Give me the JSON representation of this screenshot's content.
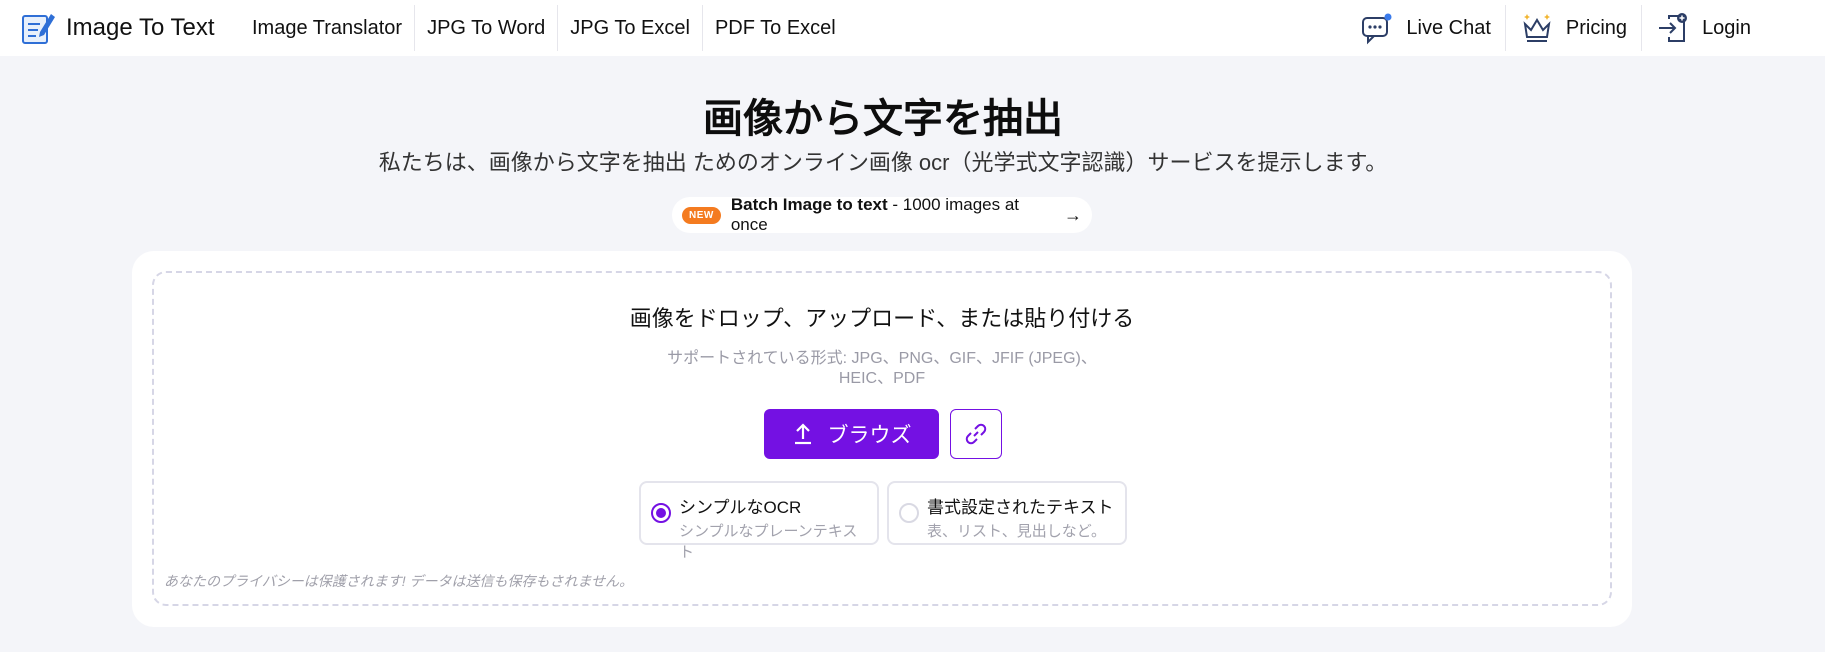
{
  "header": {
    "logo_text": "Image To Text",
    "nav": [
      "Image Translator",
      "JPG To Word",
      "JPG To Excel",
      "PDF To Excel"
    ],
    "live_chat": "Live Chat",
    "pricing": "Pricing",
    "login": "Login"
  },
  "hero": {
    "title": "画像から文字を抽出",
    "subtitle": "私たちは、画像から文字を抽出 ためのオンライン画像 ocr（光学式文字認識）サービスを提示します。",
    "badge_new": "NEW",
    "badge_bold": "Batch Image to text",
    "badge_rest": " - 1000 images at once",
    "badge_arrow": "→"
  },
  "upload": {
    "title": "画像をドロップ、アップロード、または貼り付ける",
    "formats_line1": "サポートされている形式: JPG、PNG、GIF、JFIF (JPEG)、",
    "formats_line2": "HEIC、PDF",
    "browse_label": "ブラウズ",
    "options": [
      {
        "title": "シンプルなOCR",
        "subtitle": "シンプルなプレーンテキスト",
        "selected": true
      },
      {
        "title": "書式設定されたテキスト",
        "subtitle": "表、リスト、見出しなど。",
        "selected": false
      }
    ],
    "privacy": "あなたのプライバシーは保護されます! データは送信も保存もされません。"
  },
  "colors": {
    "accent": "#7411e3",
    "badge": "#f47b20",
    "background": "#f4f5f9"
  }
}
